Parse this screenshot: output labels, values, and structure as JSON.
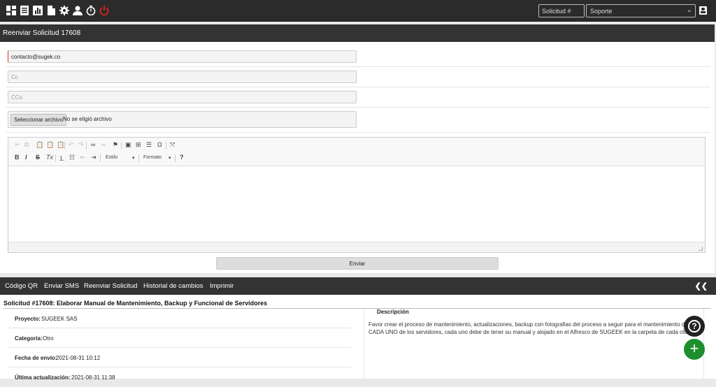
{
  "topbar": {
    "icons": [
      "dashboard-icon",
      "list-icon",
      "chart-icon",
      "document-icon",
      "gear-icon",
      "user-icon",
      "stopwatch-icon",
      "power-icon"
    ],
    "search_placeholder": "Solicitud #",
    "select_value": "Soporte"
  },
  "form": {
    "title": "Reenviar Solicitud 17608",
    "to_value": "contacto@sugek.co",
    "cc_placeholder": "Cc",
    "cco_placeholder": "CCo",
    "file_button": "Seleccionar archivo",
    "file_status": "No se eligió archivo",
    "editor": {
      "style_label": "Estilo",
      "format_label": "Formato",
      "bold": "B",
      "italic": "I",
      "strike": "S",
      "help": "?"
    },
    "send_label": "Enviar"
  },
  "menu": {
    "items": [
      "Código QR",
      "Enviar SMS",
      "Reenviar Solicitud",
      "Historial de cambios",
      "Imprimir"
    ],
    "collapse": "❮❮"
  },
  "request": {
    "title": "Solicitud #17608: Elaborar Manual de Mantenimiento, Backup y Funcional de Servidores",
    "fields": [
      {
        "label": "Proyecto:",
        "value": "SUGEEK SAS"
      },
      {
        "label": "Categoría:",
        "value": "Otro"
      },
      {
        "label": "Fecha de envío:",
        "value": "2021-08-31 10:12"
      },
      {
        "label": "Última actualización:",
        "value": "2021-08-31 11:38"
      }
    ],
    "description_label": "Descripción",
    "description_text": "Favor crear el proceso de mantenimiento, actualizaciones, backup con fotografias del proceso a seguir para el mantenimiento de CADA UNO de los servidores, cada uno debe de tener su manual y alojado en el Alfresco de SUGEEK en la carpeta de cada cliente,"
  },
  "fab": {
    "help": "?",
    "add": "+"
  },
  "colors": {
    "dark_bar": "#333333",
    "power_red": "#e02020",
    "fab_green": "#1d8f2e"
  }
}
